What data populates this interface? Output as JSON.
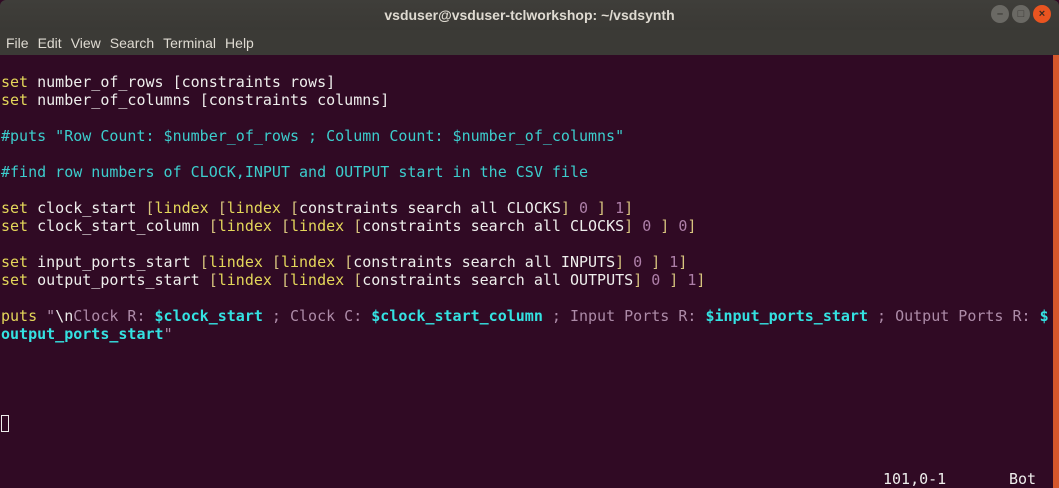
{
  "window": {
    "title": "vsduser@vsduser-tclworkshop: ~/vsdsynth",
    "buttons": {
      "minimize": "–",
      "maximize": "□",
      "close": "×"
    }
  },
  "menu": [
    "File",
    "Edit",
    "View",
    "Search",
    "Terminal",
    "Help"
  ],
  "lines": [
    {
      "row": 1,
      "segs": [
        {
          "t": "set",
          "c": "kw"
        },
        {
          "t": " number_of_rows ",
          "c": "tx"
        },
        {
          "t": "[constraints rows]",
          "c": "tx"
        }
      ]
    },
    {
      "row": 2,
      "segs": [
        {
          "t": "set",
          "c": "kw"
        },
        {
          "t": " number_of_columns ",
          "c": "tx"
        },
        {
          "t": "[constraints columns]",
          "c": "tx"
        }
      ]
    },
    {
      "row": 4,
      "segs": [
        {
          "t": "#puts \"Row Count: $number_of_rows ; Column Count: $number_of_columns\"",
          "c": "cm"
        }
      ]
    },
    {
      "row": 6,
      "segs": [
        {
          "t": "#find row numbers of CLOCK,INPUT and OUTPUT start in the CSV file",
          "c": "cm"
        }
      ]
    },
    {
      "row": 8,
      "segs": [
        {
          "t": "set",
          "c": "kw"
        },
        {
          "t": " clock_start ",
          "c": "tx"
        },
        {
          "t": "[",
          "c": "br"
        },
        {
          "t": "lindex",
          "c": "kw"
        },
        {
          "t": " [",
          "c": "br"
        },
        {
          "t": "lindex",
          "c": "kw"
        },
        {
          "t": " [",
          "c": "br"
        },
        {
          "t": "constraints search all CLOCKS",
          "c": "tx"
        },
        {
          "t": "]",
          "c": "br"
        },
        {
          "t": " 0",
          "c": "num"
        },
        {
          "t": " ]",
          "c": "br"
        },
        {
          "t": " 1",
          "c": "num"
        },
        {
          "t": "]",
          "c": "br"
        }
      ]
    },
    {
      "row": 9,
      "segs": [
        {
          "t": "set",
          "c": "kw"
        },
        {
          "t": " clock_start_column ",
          "c": "tx"
        },
        {
          "t": "[",
          "c": "br"
        },
        {
          "t": "lindex",
          "c": "kw"
        },
        {
          "t": " [",
          "c": "br"
        },
        {
          "t": "lindex",
          "c": "kw"
        },
        {
          "t": " [",
          "c": "br"
        },
        {
          "t": "constraints search all CLOCKS",
          "c": "tx"
        },
        {
          "t": "]",
          "c": "br"
        },
        {
          "t": " 0",
          "c": "num"
        },
        {
          "t": " ]",
          "c": "br"
        },
        {
          "t": " 0",
          "c": "num"
        },
        {
          "t": "]",
          "c": "br"
        }
      ]
    },
    {
      "row": 11,
      "segs": [
        {
          "t": "set",
          "c": "kw"
        },
        {
          "t": " input_ports_start ",
          "c": "tx"
        },
        {
          "t": "[",
          "c": "br"
        },
        {
          "t": "lindex",
          "c": "kw"
        },
        {
          "t": " [",
          "c": "br"
        },
        {
          "t": "lindex",
          "c": "kw"
        },
        {
          "t": " [",
          "c": "br"
        },
        {
          "t": "constraints search all INPUTS",
          "c": "tx"
        },
        {
          "t": "]",
          "c": "br"
        },
        {
          "t": " 0",
          "c": "num"
        },
        {
          "t": " ]",
          "c": "br"
        },
        {
          "t": " 1",
          "c": "num"
        },
        {
          "t": "]",
          "c": "br"
        }
      ]
    },
    {
      "row": 12,
      "segs": [
        {
          "t": "set",
          "c": "kw"
        },
        {
          "t": " output_ports_start ",
          "c": "tx"
        },
        {
          "t": "[",
          "c": "br"
        },
        {
          "t": "lindex",
          "c": "kw"
        },
        {
          "t": " [",
          "c": "br"
        },
        {
          "t": "lindex",
          "c": "kw"
        },
        {
          "t": " [",
          "c": "br"
        },
        {
          "t": "constraints search all OUTPUTS",
          "c": "tx"
        },
        {
          "t": "]",
          "c": "br"
        },
        {
          "t": " 0",
          "c": "num"
        },
        {
          "t": " ]",
          "c": "br"
        },
        {
          "t": " 1",
          "c": "num"
        },
        {
          "t": "]",
          "c": "br"
        }
      ]
    },
    {
      "row": 14,
      "segs": [
        {
          "t": "puts",
          "c": "kw"
        },
        {
          "t": " \"",
          "c": "str"
        },
        {
          "t": "\\n",
          "c": "tx"
        },
        {
          "t": "Clock R: ",
          "c": "str"
        },
        {
          "t": "$clock_start",
          "c": "var"
        },
        {
          "t": " ; Clock C: ",
          "c": "str"
        },
        {
          "t": "$clock_start_column",
          "c": "var"
        },
        {
          "t": " ; Input Ports R: ",
          "c": "str"
        },
        {
          "t": "$input_ports_start",
          "c": "var"
        },
        {
          "t": " ; Output Ports R: ",
          "c": "str"
        },
        {
          "t": "$",
          "c": "var"
        }
      ]
    },
    {
      "row": 15,
      "segs": [
        {
          "t": "output_ports_start",
          "c": "var"
        },
        {
          "t": "\"",
          "c": "str"
        }
      ]
    }
  ],
  "status": {
    "position": "101,0-1",
    "scroll": "Bot"
  }
}
